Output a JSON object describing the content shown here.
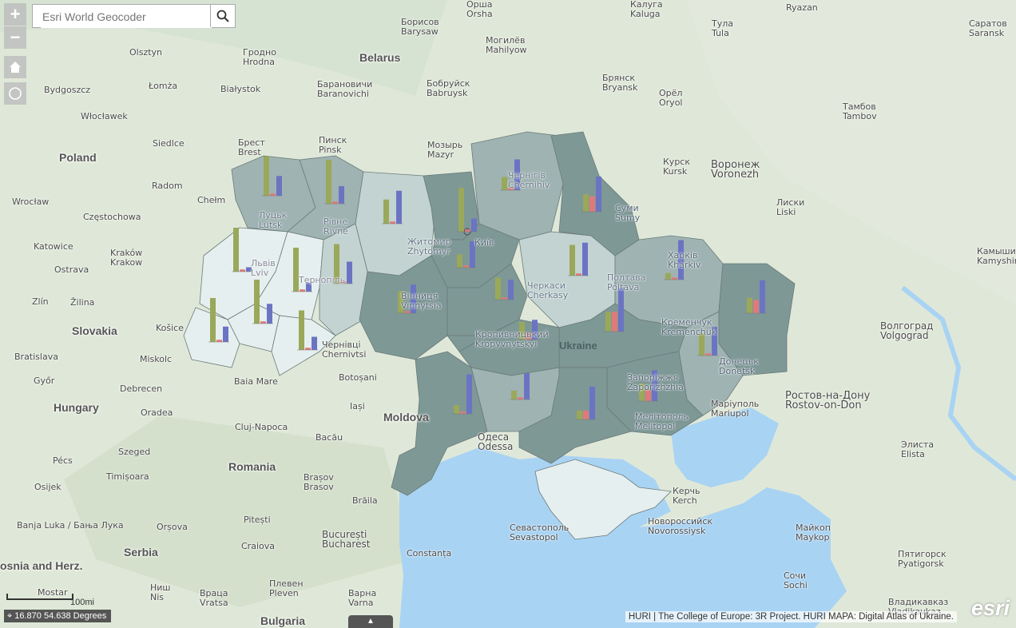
{
  "search": {
    "placeholder": "Esri World Geocoder"
  },
  "controls": {
    "zoom_in": "+",
    "zoom_out": "−"
  },
  "coordinates": "16.870 54.638 Degrees",
  "scale_label": "100mi",
  "attribution": "HURI | The College of Europe: 3R Project. HURI MAPA: Digital Atlas of Ukraine.",
  "logo_text": "esri",
  "colors": {
    "water": "#a9d3f3",
    "land": "#dfe8d8",
    "region_dark": "#7e9896",
    "region_mid": "#9fb3b2",
    "region_light": "#c3d3d2",
    "region_pale": "#e6efef",
    "bar_green": "#9aa85a",
    "bar_red": "#e07a7a",
    "bar_blue": "#6b74c2"
  },
  "countries": [
    {
      "text": "Poland"
    },
    {
      "text": "Belarus"
    },
    {
      "text": "Slovakia"
    },
    {
      "text": "Hungary"
    },
    {
      "text": "Moldova"
    },
    {
      "text": "Romania"
    },
    {
      "text": "Serbia"
    },
    {
      "text": "Bulgaria"
    },
    {
      "text": "osnia and Herz."
    },
    {
      "text": "Ukraine"
    }
  ],
  "cities": [
    {
      "text": "Olsztyn"
    },
    {
      "text": "Гродно\nHrodna"
    },
    {
      "text": "Bydgoszcz"
    },
    {
      "text": "Łomża"
    },
    {
      "text": "Białystok"
    },
    {
      "text": "Włocławek"
    },
    {
      "text": "Siedlce"
    },
    {
      "text": "Брест\nBrest"
    },
    {
      "text": "Radom"
    },
    {
      "text": "Chełm"
    },
    {
      "text": "Wrocław"
    },
    {
      "text": "Częstochowa"
    },
    {
      "text": "Katowice"
    },
    {
      "text": "Kraków\nKrakow"
    },
    {
      "text": "Ostrava"
    },
    {
      "text": "Zlín"
    },
    {
      "text": "Žilina"
    },
    {
      "text": "Košice"
    },
    {
      "text": "Bratislava"
    },
    {
      "text": "Miskolc"
    },
    {
      "text": "Győr"
    },
    {
      "text": "Debrecen"
    },
    {
      "text": "Baia Mare"
    },
    {
      "text": "Oradea"
    },
    {
      "text": "Cluj-Napoca"
    },
    {
      "text": "Szeged"
    },
    {
      "text": "Pécs"
    },
    {
      "text": "Timișoara"
    },
    {
      "text": "Osijek"
    },
    {
      "text": "Banja Luka / Бања Лука"
    },
    {
      "text": "Orșova"
    },
    {
      "text": "Pitești"
    },
    {
      "text": "Craiova"
    },
    {
      "text": "Brașov\nBrasov"
    },
    {
      "text": "Bacău"
    },
    {
      "text": "Iași"
    },
    {
      "text": "Botoșani"
    },
    {
      "text": "Brăila"
    },
    {
      "text": "București\nBucharest"
    },
    {
      "text": "Constanța"
    },
    {
      "text": "Ниш\nNis"
    },
    {
      "text": "Враца\nVratsa"
    },
    {
      "text": "Плевен\nPleven"
    },
    {
      "text": "Варна\nVarna"
    },
    {
      "text": "Mostar"
    },
    {
      "text": "Борисов\nBarysaw"
    },
    {
      "text": "Орша\nOrsha"
    },
    {
      "text": "Могилёв\nMahilyow"
    },
    {
      "text": "Барановичи\nBaranovichi"
    },
    {
      "text": "Бобруйск\nBabruysk"
    },
    {
      "text": "Пинск\nPinsk"
    },
    {
      "text": "Мозырь\nMazyr"
    },
    {
      "text": "Калуга\nKaluga"
    },
    {
      "text": "Тула\nTula"
    },
    {
      "text": "Ryazan"
    },
    {
      "text": "Саратов\nSaransk"
    },
    {
      "text": "Брянск\nBryansk"
    },
    {
      "text": "Орёл\nOryol"
    },
    {
      "text": "Тамбов\nTambov"
    },
    {
      "text": "Курск\nKursk"
    },
    {
      "text": "Воронеж\nVoronezh"
    },
    {
      "text": "Лиски\nLiski"
    },
    {
      "text": "Камышин\nKamyshin"
    },
    {
      "text": "Волгоград\nVolgograd"
    },
    {
      "text": "Ростов-на-Дону\nRostov-on-Don"
    },
    {
      "text": "Элиста\nElista"
    },
    {
      "text": "Майкоп\nMaykop"
    },
    {
      "text": "Пятигорск\nPyatigorsk"
    },
    {
      "text": "Сочи\nSochi"
    },
    {
      "text": "Владикавказ\nVladikavkaz"
    },
    {
      "text": "Новороссийск\nNovorossiysk"
    },
    {
      "text": "Керчь\nKerch"
    },
    {
      "text": "Севастополь\nSevastopol"
    },
    {
      "text": "Одеса\nOdessa"
    },
    {
      "text": "Маріуполь\nMariupol"
    },
    {
      "text": "Чернівці\nChernivtsi"
    },
    {
      "text": "Мелітополь\nMelitopol"
    },
    {
      "text": "Кропивницький\nKropyvnytskyi"
    },
    {
      "text": "Житомир\nZhytomyr"
    },
    {
      "text": "Полтава\nPoltava"
    },
    {
      "text": "Харків\nKharkiv"
    },
    {
      "text": "Донецьк\nDonetsk"
    },
    {
      "text": "Запоріжжя\nZaporizhzhia"
    },
    {
      "text": "Суми\nSumy"
    },
    {
      "text": "Чернігів\nChernihiv"
    },
    {
      "text": "Луцьк\nLutsk"
    },
    {
      "text": "Рівне\nRivne"
    },
    {
      "text": "Львів\nLviv"
    },
    {
      "text": "Тернопіль"
    },
    {
      "text": "Вінниця\nVinnytsia"
    },
    {
      "text": "Черкаси\nCherkasy"
    },
    {
      "text": "Кременчук\nKremenchuk"
    },
    {
      "text": "Київ"
    }
  ],
  "regions": [
    {
      "shade": "mid",
      "bars": [
        0.9,
        0.05,
        0.45
      ]
    },
    {
      "shade": "mid",
      "bars": [
        1.0,
        0.05,
        0.4
      ]
    },
    {
      "shade": "light",
      "bars": [
        0.55,
        0.05,
        0.75
      ]
    },
    {
      "shade": "dark",
      "bars": [
        1.0,
        0.05,
        0.3
      ]
    },
    {
      "shade": "mid",
      "bars": [
        0.3,
        0.05,
        0.7
      ]
    },
    {
      "shade": "dark",
      "bars": [
        0.3,
        0.05,
        0.6
      ]
    },
    {
      "shade": "pale",
      "bars": [
        1.0,
        0.05,
        0.1
      ]
    },
    {
      "shade": "pale",
      "bars": [
        1.0,
        0.05,
        0.2
      ]
    },
    {
      "shade": "light",
      "bars": [
        0.9,
        0.05,
        0.5
      ]
    },
    {
      "shade": "pale",
      "bars": [
        1.0,
        0.05,
        0.35
      ]
    },
    {
      "shade": "pale",
      "bars": [
        1.0,
        0.05,
        0.45
      ]
    },
    {
      "shade": "pale",
      "bars": [
        0.9,
        0.05,
        0.3
      ]
    },
    {
      "shade": "dark",
      "bars": [
        0.5,
        0.05,
        0.65
      ]
    },
    {
      "shade": "dark",
      "bars": [
        0.5,
        0.05,
        0.45
      ]
    },
    {
      "shade": "dark",
      "bars": [
        0.4,
        0.15,
        0.45
      ]
    },
    {
      "shade": "light",
      "bars": [
        0.7,
        0.05,
        0.75
      ]
    },
    {
      "shade": "dark",
      "bars": [
        0.4,
        0.35,
        0.8
      ]
    },
    {
      "shade": "mid",
      "bars": [
        0.15,
        0.05,
        0.9
      ]
    },
    {
      "shade": "dark",
      "bars": [
        0.35,
        0.3,
        0.75
      ]
    },
    {
      "shade": "dark",
      "bars": [
        0.45,
        0.45,
        1.0
      ]
    },
    {
      "shade": "mid",
      "bars": [
        0.5,
        0.05,
        0.65
      ]
    },
    {
      "shade": "dark",
      "bars": [
        0.4,
        0.25,
        0.7
      ]
    },
    {
      "shade": "dark",
      "bars": [
        0.2,
        0.2,
        0.75
      ]
    },
    {
      "shade": "dark",
      "bars": [
        0.2,
        0.05,
        0.9
      ]
    },
    {
      "shade": "mid",
      "bars": [
        0.2,
        0.05,
        0.6
      ]
    },
    {
      "shade": "dark",
      "bars": [
        0.0,
        0.0,
        0.0
      ]
    },
    {
      "shade": "pale",
      "bars": [
        0.0,
        0.0,
        0.0
      ]
    }
  ]
}
